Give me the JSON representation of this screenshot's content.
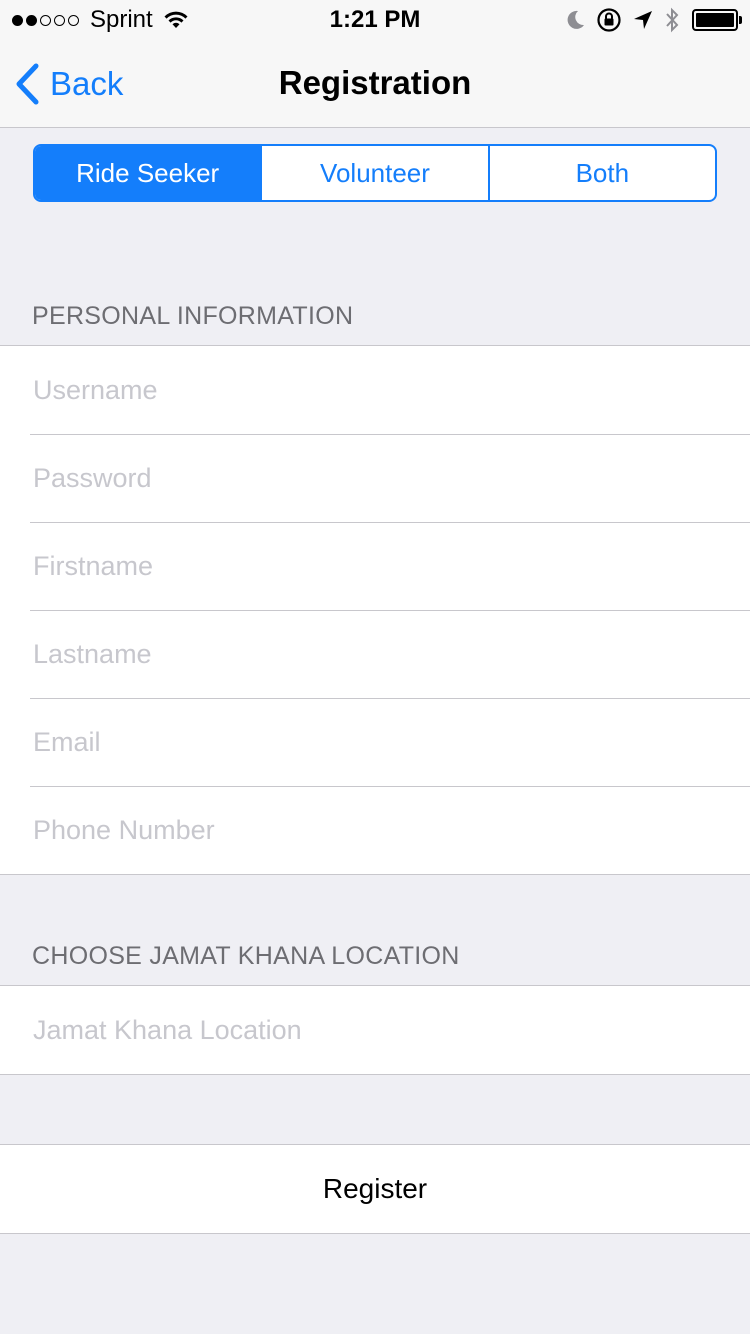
{
  "status_bar": {
    "carrier": "Sprint",
    "time": "1:21 PM",
    "signal_bars_filled": 2,
    "signal_bars_total": 5,
    "icons": [
      "wifi-icon",
      "moon-icon",
      "rotation-lock-icon",
      "location-arrow-icon",
      "bluetooth-icon",
      "battery-icon"
    ]
  },
  "nav": {
    "back_label": "Back",
    "title": "Registration"
  },
  "segments": [
    {
      "label": "Ride Seeker",
      "selected": true
    },
    {
      "label": "Volunteer",
      "selected": false
    },
    {
      "label": "Both",
      "selected": false
    }
  ],
  "personal": {
    "header": "PERSONAL INFORMATION",
    "fields": [
      {
        "placeholder": "Username",
        "value": ""
      },
      {
        "placeholder": "Password",
        "value": ""
      },
      {
        "placeholder": "Firstname",
        "value": ""
      },
      {
        "placeholder": "Lastname",
        "value": ""
      },
      {
        "placeholder": "Email",
        "value": ""
      },
      {
        "placeholder": "Phone Number",
        "value": ""
      }
    ]
  },
  "location": {
    "header": "CHOOSE JAMAT KHANA LOCATION",
    "field": {
      "placeholder": "Jamat Khana Location",
      "value": ""
    }
  },
  "register_label": "Register",
  "colors": {
    "accent": "#147efb",
    "background": "#efeff4",
    "separator": "#c8c7cc",
    "placeholder": "#c7c7cd",
    "header_text": "#6d6d72"
  }
}
